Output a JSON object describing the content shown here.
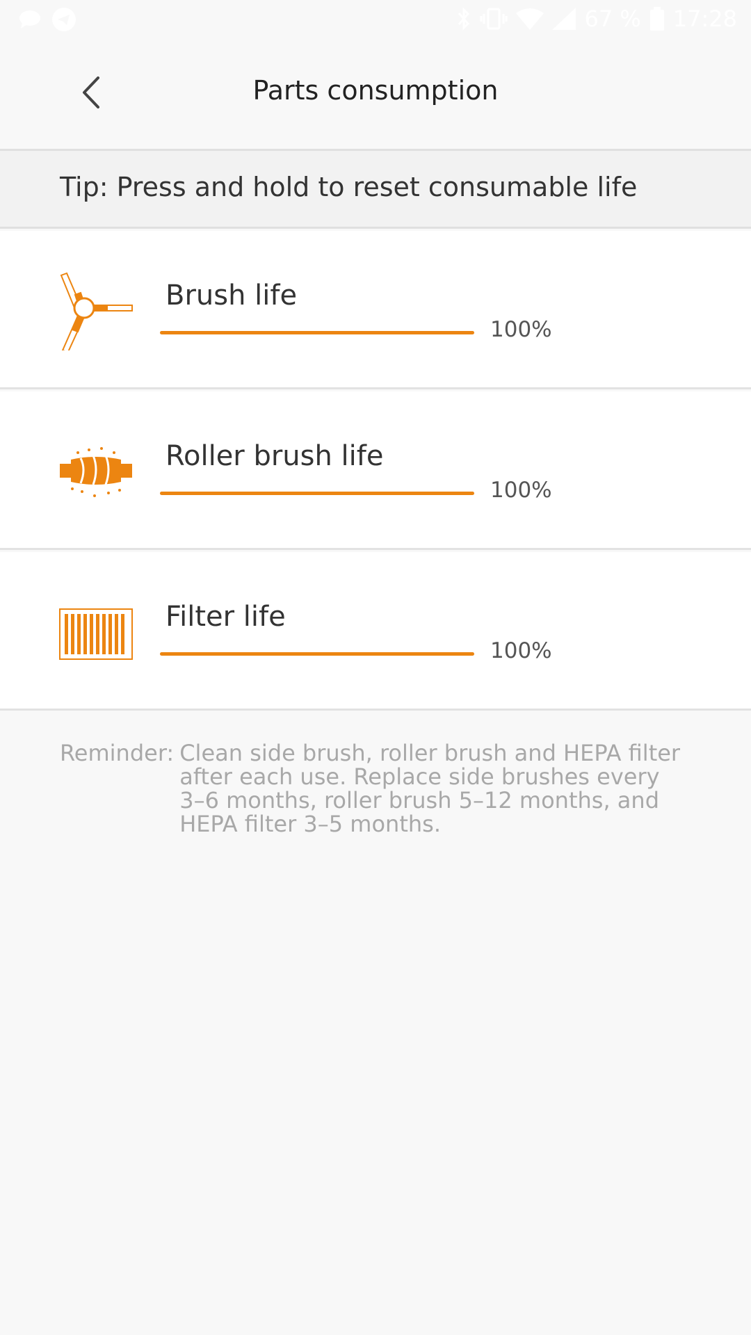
{
  "status_bar": {
    "battery_text": "67 %",
    "time": "17:28"
  },
  "header": {
    "title": "Parts consumption"
  },
  "tip": {
    "text": "Tip: Press and hold to reset consumable life"
  },
  "parts": [
    {
      "label": "Brush life",
      "percent_text": "100%",
      "percent": 100,
      "icon": "side-brush-icon"
    },
    {
      "label": "Roller brush life",
      "percent_text": "100%",
      "percent": 100,
      "icon": "roller-brush-icon"
    },
    {
      "label": "Filter life",
      "percent_text": "100%",
      "percent": 100,
      "icon": "filter-icon"
    }
  ],
  "reminder": {
    "label": "Reminder:",
    "text": "Clean side brush, roller brush and HEPA filter after each use. Replace side brushes every 3–6 months, roller brush 5–12 months, and HEPA filter 3–5 months."
  },
  "colors": {
    "accent": "#ec8511",
    "background": "#f8f8f8"
  }
}
